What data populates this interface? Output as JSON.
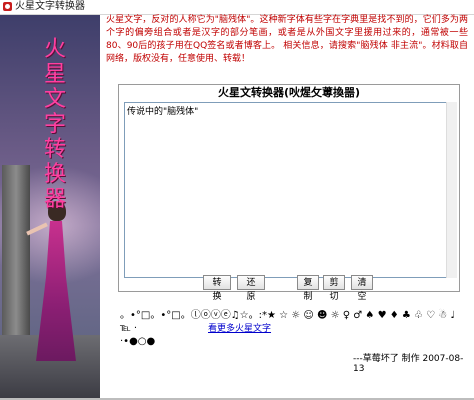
{
  "window": {
    "title": "火星文字转换器"
  },
  "sidebar": {
    "vertical_title": [
      "火",
      "星",
      "文",
      "字",
      "转",
      "换",
      "器"
    ]
  },
  "intro_text": "火星文字，反对的人称它为\"脑残体\"。这种新字体有些字在字典里是找不到的，它们多为两个字的偏旁组合或者是汉字的部分笔画，或者是从外国文字里援用过来的，通常被一些80、90后的孩子用在QQ签名或者博客上。 相关信息，请搜索\"脑残体 非主流\"。材料取自网络，版权没有，任意使用、转载！",
  "converter": {
    "heading": "火星文转换器(吙煋攵蒪換噐)",
    "text_value": "传说中的\"脑残体\""
  },
  "buttons": {
    "convert": "转 换",
    "restore": "还 原",
    "copy": "复制",
    "cut": "剪切",
    "clear": "清空"
  },
  "symbols": {
    "line1": "。•°□。•°□。ⓛⓞⓥⓔ♫☆。:*★ ☆ ☼ ☺ ☻ ☼ ♀ ♂ ♠ ♥ ♦ ♣ ♧ ♡ ☃ ♩ ℡ ·",
    "line2": "·•●○●"
  },
  "more_link": "看更多火星文字",
  "signature": "---草莓坏了 制作 2007-08-13"
}
